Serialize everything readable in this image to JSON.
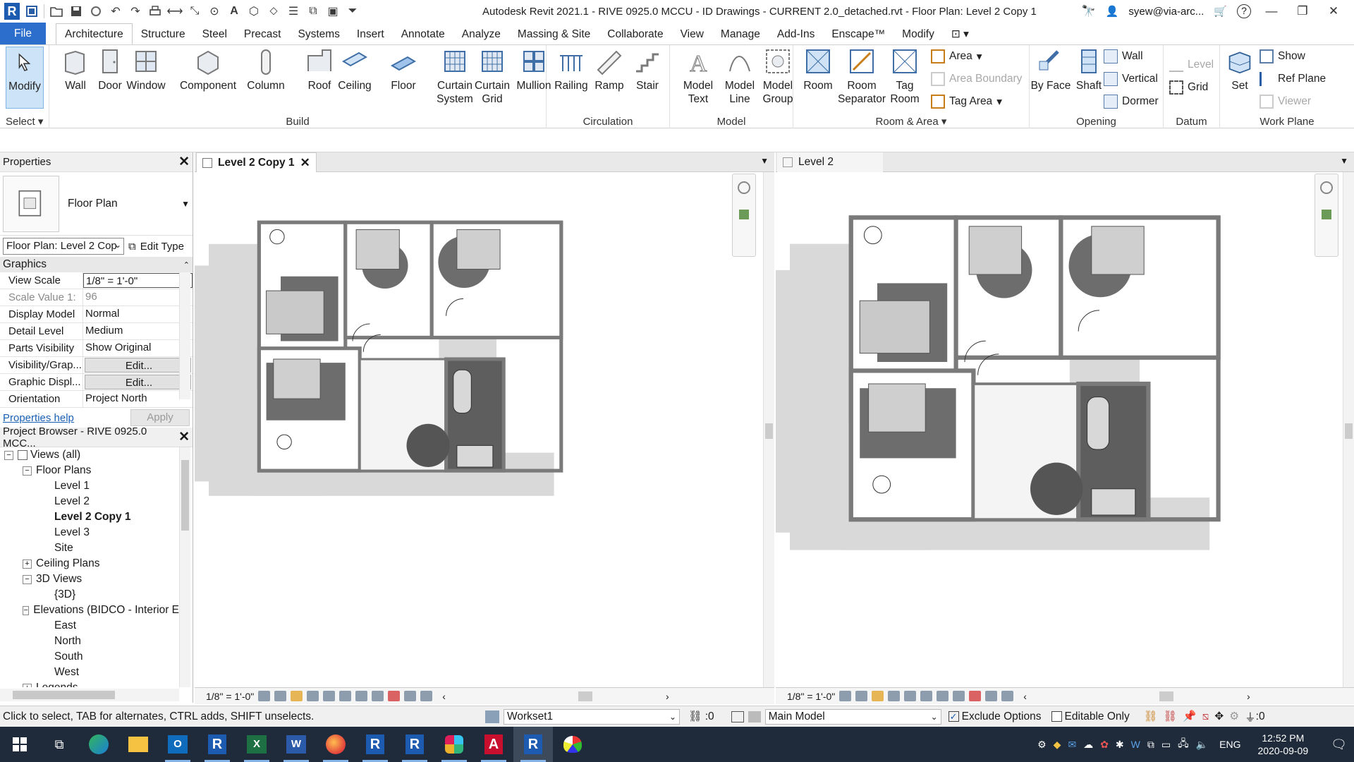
{
  "app": {
    "title": "Autodesk Revit 2021.1 - RIVE 0925.0 MCCU - ID Drawings - CURRENT 2.0_detached.rvt - Floor Plan: Level 2 Copy 1",
    "user": "syew@via-arc...",
    "logo_letter": "R"
  },
  "ribbon_tabs": [
    "File",
    "Architecture",
    "Structure",
    "Steel",
    "Precast",
    "Systems",
    "Insert",
    "Annotate",
    "Analyze",
    "Massing & Site",
    "Collaborate",
    "View",
    "Manage",
    "Add-Ins",
    "Enscape™",
    "Modify"
  ],
  "ribbon": {
    "select_label": "Select",
    "modify": "Modify",
    "build": {
      "label": "Build",
      "tools": [
        "Wall",
        "Door",
        "Window",
        "Component",
        "Column",
        "Roof",
        "Ceiling",
        "Floor",
        "Curtain System",
        "Curtain Grid",
        "Mullion"
      ]
    },
    "circulation": {
      "label": "Circulation",
      "tools": [
        "Railing",
        "Ramp",
        "Stair"
      ]
    },
    "model": {
      "label": "Model",
      "tools": [
        "Model Text",
        "Model Line",
        "Model Group"
      ]
    },
    "room_area": {
      "label": "Room & Area",
      "tools": [
        "Room",
        "Room Separator",
        "Tag Room"
      ],
      "small": [
        "Area",
        "Area  Boundary",
        "Tag  Area"
      ]
    },
    "opening": {
      "label": "Opening",
      "tools": [
        "By Face",
        "Shaft"
      ],
      "small": [
        "Wall",
        "Vertical",
        "Dormer"
      ]
    },
    "datum": {
      "label": "Datum",
      "small": [
        "Level",
        "Grid"
      ]
    },
    "work_plane": {
      "label": "Work Plane",
      "tools": [
        "Set"
      ],
      "small": [
        "Show",
        "Ref  Plane",
        "Viewer"
      ]
    }
  },
  "properties": {
    "header": "Properties",
    "type_name": "Floor Plan",
    "selector": "Floor Plan: Level 2 Cop",
    "edit_type": "Edit Type",
    "section": "Graphics",
    "rows": [
      {
        "k": "View Scale",
        "v": "1/8\" = 1'-0\""
      },
      {
        "k": "Scale Value    1:",
        "v": "96"
      },
      {
        "k": "Display Model",
        "v": "Normal"
      },
      {
        "k": "Detail Level",
        "v": "Medium"
      },
      {
        "k": "Parts Visibility",
        "v": "Show Original"
      },
      {
        "k": "Visibility/Grap...",
        "v": "Edit..."
      },
      {
        "k": "Graphic Displ...",
        "v": "Edit..."
      },
      {
        "k": "Orientation",
        "v": "Project North"
      }
    ],
    "help": "Properties help",
    "apply": "Apply"
  },
  "browser": {
    "header": "Project Browser - RIVE 0925.0 MCC...",
    "nodes": [
      {
        "label": "Views (all)",
        "depth": 0,
        "exp": "-"
      },
      {
        "label": "Floor Plans",
        "depth": 1,
        "exp": "-"
      },
      {
        "label": "Level 1",
        "depth": 2
      },
      {
        "label": "Level 2",
        "depth": 2
      },
      {
        "label": "Level 2 Copy 1",
        "depth": 2,
        "bold": true
      },
      {
        "label": "Level 3",
        "depth": 2
      },
      {
        "label": "Site",
        "depth": 2
      },
      {
        "label": "Ceiling Plans",
        "depth": 1,
        "exp": "+"
      },
      {
        "label": "3D Views",
        "depth": 1,
        "exp": "-"
      },
      {
        "label": "{3D}",
        "depth": 2
      },
      {
        "label": "Elevations (BIDCO - Interior E",
        "depth": 1,
        "exp": "-"
      },
      {
        "label": "East",
        "depth": 2
      },
      {
        "label": "North",
        "depth": 2
      },
      {
        "label": "South",
        "depth": 2
      },
      {
        "label": "West",
        "depth": 2
      },
      {
        "label": "Legends",
        "depth": 1,
        "exp": "+"
      }
    ]
  },
  "views": {
    "left_tab": "Level 2 Copy 1",
    "right_tab": "Level 2",
    "scale": "1/8\" = 1'-0\""
  },
  "status": {
    "hint": "Click to select, TAB for alternates, CTRL adds, SHIFT unselects.",
    "workset": "Workset1",
    "count": ":0",
    "model": "Main Model",
    "exclude_options": "Exclude Options",
    "editable_only": "Editable Only",
    "filter_count": ":0"
  },
  "taskbar": {
    "lang": "ENG",
    "time": "12:52 PM",
    "date": "2020-09-09"
  },
  "colors": {
    "file_tab": "#2c6ecb",
    "taskbar": "#1f2b3a",
    "selected_tool": "#cde3f7"
  }
}
